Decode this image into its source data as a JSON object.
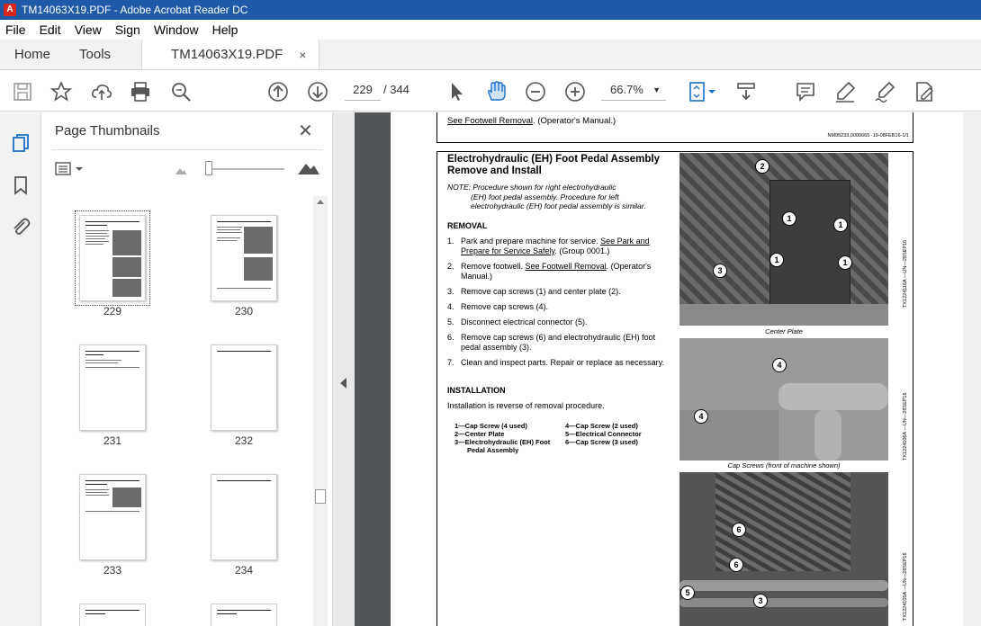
{
  "window": {
    "title": "TM14063X19.PDF - Adobe Acrobat Reader DC"
  },
  "menu": [
    "File",
    "Edit",
    "View",
    "Sign",
    "Window",
    "Help"
  ],
  "tabs": {
    "home": "Home",
    "tools": "Tools",
    "document": "TM14063X19.PDF",
    "close": "×"
  },
  "toolbar": {
    "page_current": "229",
    "page_total": "/  344",
    "zoom": "66.7%"
  },
  "thumbnails": {
    "title": "Page Thumbnails",
    "close": "✕",
    "pages": [
      "229",
      "230",
      "231",
      "232",
      "233",
      "234"
    ]
  },
  "document": {
    "top_ref_link": "See Footwell Removal",
    "top_ref_suffix": ". (Operator's Manual.)",
    "top_code": "NM95233,0000665 -19-08FEB16-1/1",
    "title_line1": "Electrohydraulic (EH) Foot Pedal Assembly",
    "title_line2": "Remove and Install",
    "note_line1": "NOTE: Procedure shown for right electrohydraulic",
    "note_line2": "(EH) foot pedal assembly.  Procedure for left",
    "note_line3": "electrohydraulic (EH) foot pedal assembly is similar.",
    "removal_heading": "REMOVAL",
    "steps": [
      {
        "num": "1.",
        "pre": "Park and prepare machine for service. ",
        "link": "See Park and Prepare for Service Safely",
        "post": ". (Group 0001.)"
      },
      {
        "num": "2.",
        "pre": "Remove footwell. ",
        "link": "See Footwell Removal",
        "post": ". (Operator's Manual.)"
      },
      {
        "num": "3.",
        "pre": "Remove cap screws (1) and center plate (2).",
        "link": "",
        "post": ""
      },
      {
        "num": "4.",
        "pre": "Remove cap screws (4).",
        "link": "",
        "post": ""
      },
      {
        "num": "5.",
        "pre": "Disconnect electrical connector (5).",
        "link": "",
        "post": ""
      },
      {
        "num": "6.",
        "pre": "Remove cap screws (6) and electrohydraulic (EH) foot pedal assembly (3).",
        "link": "",
        "post": ""
      },
      {
        "num": "7.",
        "pre": "Clean and inspect parts.  Repair or replace as necessary.",
        "link": "",
        "post": ""
      }
    ],
    "installation_heading": "INSTALLATION",
    "installation_text": "Installation is reverse of removal procedure.",
    "legend_left": [
      "1—Cap Screw (4 used)",
      "2—Center Plate",
      "3—Electrohydraulic (EH) Foot",
      "Pedal Assembly"
    ],
    "legend_right": [
      "4—Cap Screw (2 used)",
      "5—Electrical Connector",
      "6—Cap Screw (3 used)"
    ],
    "caption1": "Center Plate",
    "caption2": "Cap Screws (front of machine shown)",
    "vcode1": "TX1224116A —UN—28SEP16",
    "vcode2": "TX1224106A —UN—28SEP16",
    "vcode3": "TX1224105A —UN—28SEP16",
    "callouts_photo1": [
      "2",
      "1",
      "1",
      "3",
      "1",
      "1"
    ],
    "callouts_photo2": [
      "4",
      "4"
    ],
    "callouts_photo3": [
      "6",
      "6",
      "5",
      "3"
    ]
  }
}
